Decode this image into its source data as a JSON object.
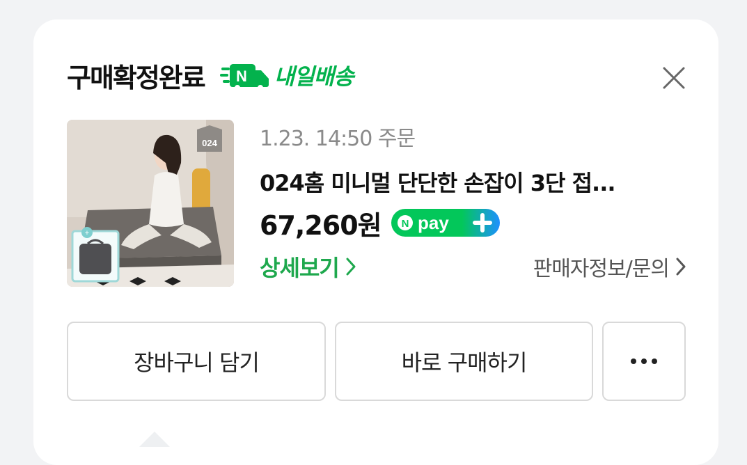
{
  "order": {
    "status_title": "구매확정완료",
    "delivery_badge": "내일배송",
    "date": "1.23. 14:50 주문",
    "product_name": "024홈 미니멀 단단한 손잡이 3단 접...",
    "price": "67,260원",
    "npay_label": "pay",
    "detail_link": "상세보기",
    "seller_link": "판매자정보/문의",
    "thumbnail_tag": "024"
  },
  "actions": {
    "cart_label": "장바구니 담기",
    "buy_label": "바로 구매하기"
  },
  "icons": {
    "close": "close-icon",
    "delivery": "truck-icon",
    "chevron": "chevron-right-icon",
    "more": "more-dots-icon"
  },
  "colors": {
    "accent_green": "#03b24d",
    "link_green": "#1ea84d",
    "npay_green": "#03c75a",
    "npay_blue": "#1e90ff"
  }
}
